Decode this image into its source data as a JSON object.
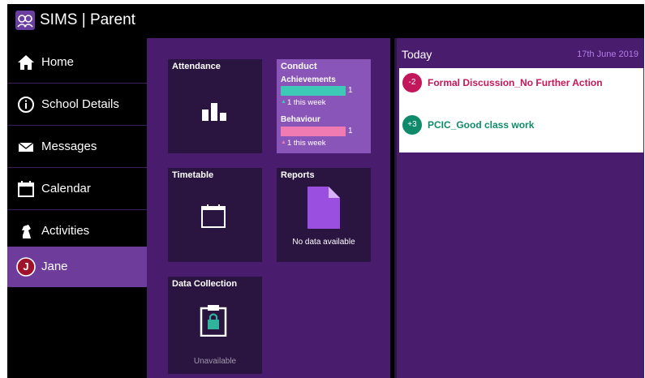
{
  "app": {
    "title": "SIMS | Parent"
  },
  "sidebar": {
    "items": [
      {
        "label": "Home",
        "icon": "home-icon"
      },
      {
        "label": "School Details",
        "icon": "info-icon"
      },
      {
        "label": "Messages",
        "icon": "envelope-icon"
      },
      {
        "label": "Calendar",
        "icon": "calendar-icon"
      },
      {
        "label": "Activities",
        "icon": "chess-knight-icon"
      },
      {
        "label": "Jane",
        "icon": "student-avatar",
        "avatar_letter": "J",
        "active": true
      }
    ]
  },
  "tiles": {
    "attendance": {
      "title": "Attendance",
      "icon": "bar-chart-icon"
    },
    "conduct": {
      "title": "Conduct",
      "achievements": {
        "label": "Achievements",
        "value": "1",
        "week": "1 this week",
        "color": "#3ec9b7"
      },
      "behaviour": {
        "label": "Behaviour",
        "value": "1",
        "week": "1 this week",
        "color": "#f07ab2"
      }
    },
    "timetable": {
      "title": "Timetable",
      "icon": "calendar-icon"
    },
    "reports": {
      "title": "Reports",
      "icon": "document-icon",
      "status": "No data available"
    },
    "data_collection": {
      "title": "Data Collection",
      "icon": "clipboard-lock-icon",
      "status": "Unavailable"
    }
  },
  "today": {
    "title": "Today",
    "date": "17th June 2019",
    "events": [
      {
        "badge": "-2",
        "text": "Formal Discussion_No Further Action",
        "color": "#c2185b"
      },
      {
        "badge": "+3",
        "text": "PCIC_Good class work",
        "color": "#0f8a6a"
      }
    ]
  },
  "colors": {
    "accent": "#6e3d9b",
    "panel": "#4a1c6e",
    "tile": "#2a1440"
  }
}
